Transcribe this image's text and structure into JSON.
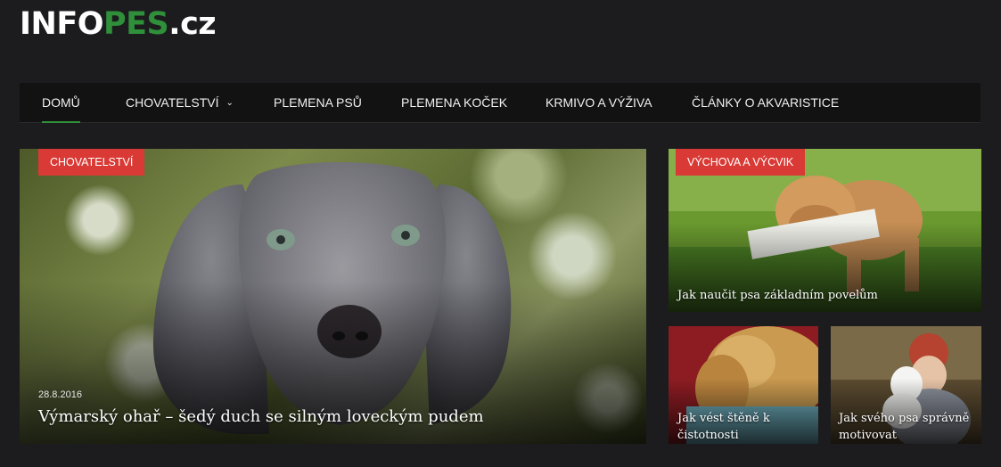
{
  "site": {
    "logo_a": "INFO",
    "logo_b": "PES",
    "logo_c": ".",
    "logo_d": "cz",
    "accent": "#2f8f3a",
    "badge_color": "#d93a35"
  },
  "nav": [
    {
      "label": "DOMŮ"
    },
    {
      "label": "CHOVATELSTVÍ",
      "icon": "chevron-down-icon"
    },
    {
      "label": "PLEMENA PSŮ"
    },
    {
      "label": "PLEMENA KOČEK"
    },
    {
      "label": "KRMIVO A VÝŽIVA"
    },
    {
      "label": "ČLÁNKY O AKVARISTICE"
    }
  ],
  "featured": {
    "main": {
      "category": "CHOVATELSTVÍ",
      "date": "28.8.2016",
      "title": "Výmarský ohař – šedý duch se silným loveckým pudem"
    },
    "side_top": {
      "category": "VÝCHOVA A VÝCVIK",
      "title": "Jak naučit psa základním povelům"
    },
    "side_left": {
      "title_line1": "Jak vést štěně k",
      "title_line2": "čistotnosti"
    },
    "side_right": {
      "title_line1": "Jak svého psa správně",
      "title_line2": "motivovat"
    }
  }
}
